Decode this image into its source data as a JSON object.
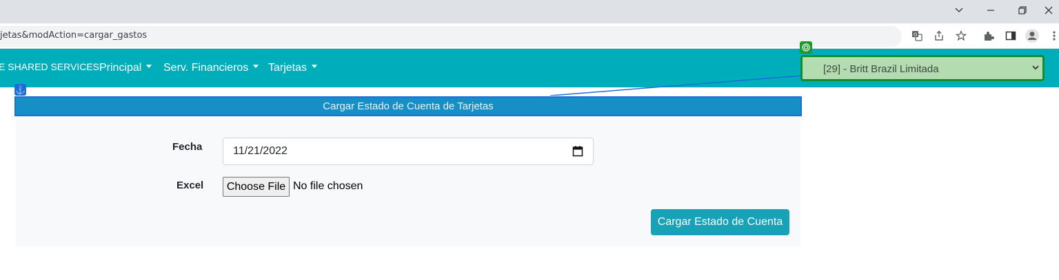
{
  "browser": {
    "url": "jetas&modAction=cargar_gastos",
    "window_controls": [
      "chevron-down-icon",
      "minimize-icon",
      "restore-icon",
      "close-icon"
    ],
    "toolbar_icons": [
      "translate-icon",
      "share-icon",
      "star-icon",
      "extensions-icon",
      "sidepanel-icon",
      "profile-icon",
      "kebab-menu-icon"
    ]
  },
  "navbar": {
    "brand": "E SHARED SERVICES",
    "items": [
      {
        "label": "Principal"
      },
      {
        "label": "Serv. Financieros"
      },
      {
        "label": "Tarjetas"
      }
    ],
    "company_select": "[29] - Britt Brazil Limitada",
    "colors": {
      "navbar_bg": "#00adbb",
      "select_bg": "#b3dcb0",
      "select_border": "#0e8f2b"
    }
  },
  "form": {
    "title": "Cargar Estado de Cuenta de Tarjetas",
    "fecha_label": "Fecha",
    "fecha_value": "11/21/2022",
    "excel_label": "Excel",
    "file_button": "Choose File",
    "file_status": "No file chosen",
    "submit": "Cargar Estado de Cuenta",
    "colors": {
      "header_bg": "#168fc6",
      "submit_bg": "#17a2b8"
    }
  }
}
